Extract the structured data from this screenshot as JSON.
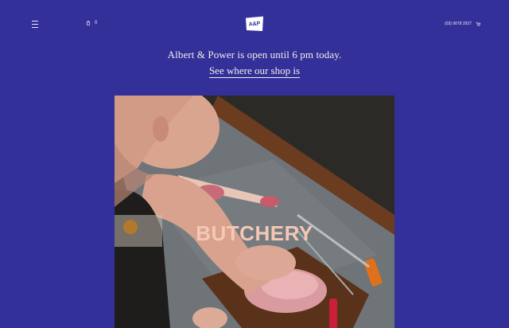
{
  "header": {
    "menu_icon": "hamburger-icon",
    "bag_icon": "bag-icon",
    "bag_count": "0",
    "logo_text": "A&P",
    "phone": "(03) 9078 2927",
    "cart_icon": "cart-icon"
  },
  "notice": {
    "text": "Albert & Power is open until 6 pm today.",
    "link": "See where our shop is"
  },
  "hero": {
    "title": "BUTCHERY"
  },
  "colors": {
    "background": "#33309a",
    "text": "#f2efe6",
    "hero_title": "#f4c8b4"
  }
}
